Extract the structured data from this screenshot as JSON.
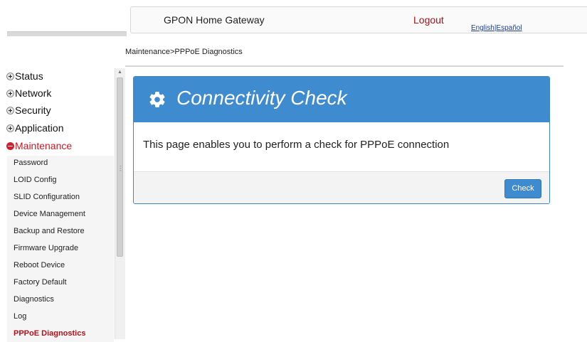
{
  "header": {
    "title": "GPON Home Gateway",
    "logout": "Logout",
    "lang_english": "English",
    "lang_separator": "|",
    "lang_spanish": "Español"
  },
  "breadcrumb": "Maintenance>PPPoE Diagnostics",
  "sidebar": {
    "top_items": [
      {
        "label": "Status",
        "icon": "plus-icon"
      },
      {
        "label": "Network",
        "icon": "plus-icon"
      },
      {
        "label": "Security",
        "icon": "plus-icon"
      },
      {
        "label": "Application",
        "icon": "plus-icon"
      },
      {
        "label": "Maintenance",
        "icon": "minus-icon",
        "active": true
      }
    ],
    "sub_items": [
      "Password",
      "LOID Config",
      "SLID Configuration",
      "Device Management",
      "Backup and Restore",
      "Firmware Upgrade",
      "Reboot Device",
      "Factory Default",
      "Diagnostics",
      "Log",
      "PPPoE Diagnostics"
    ]
  },
  "panel": {
    "title": "Connectivity Check",
    "description": "This page enables you to perform a check for PPPoE connection",
    "check_button": "Check",
    "icon": "gear-icon"
  },
  "colors": {
    "accent_blue": "#3f8bd0",
    "active_red": "#c21d24",
    "logout_red": "#a0141a"
  }
}
